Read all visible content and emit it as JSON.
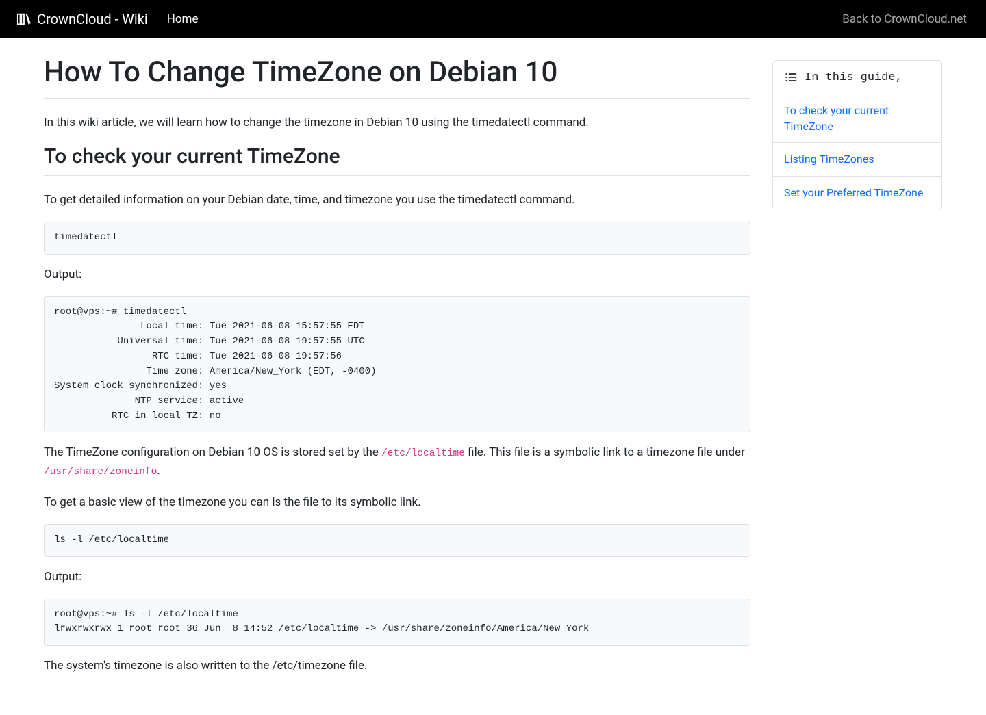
{
  "nav": {
    "brand": "CrownCloud - Wiki",
    "home": "Home",
    "back": "Back to CrownCloud.net"
  },
  "page": {
    "title": "How To Change TimeZone on Debian 10",
    "intro": "In this wiki article, we will learn how to change the timezone in Debian 10 using the timedatectl command.",
    "section1": {
      "heading": "To check your current TimeZone",
      "p1": "To get detailed information on your Debian date, time, and timezone you use the timedatectl command.",
      "code1": "timedatectl",
      "output_label_1": "Output:",
      "code2": "root@vps:~# timedatectl\n               Local time: Tue 2021-06-08 15:57:55 EDT\n           Universal time: Tue 2021-06-08 19:57:55 UTC\n                 RTC time: Tue 2021-06-08 19:57:56\n                Time zone: America/New_York (EDT, -0400)\nSystem clock synchronized: yes\n              NTP service: active\n          RTC in local TZ: no",
      "p2a": "The TimeZone configuration on Debian 10 OS is stored set by the ",
      "inline1": "/etc/localtime",
      "p2b": " file. This file is a symbolic link to a timezone file under ",
      "inline2": "/usr/share/zoneinfo",
      "p2c": ".",
      "p3": "To get a basic view of the timezone you can ls the file to its symbolic link.",
      "code3": "ls -l /etc/localtime",
      "output_label_2": "Output:",
      "code4": "root@vps:~# ls -l /etc/localtime\nlrwxrwxrwx 1 root root 36 Jun  8 14:52 /etc/localtime -> /usr/share/zoneinfo/America/New_York",
      "p4": "The system's timezone is also written to the /etc/timezone file."
    }
  },
  "toc": {
    "title": "In this guide,",
    "items": [
      "To check your current TimeZone",
      "Listing TimeZones",
      "Set your Preferred TimeZone"
    ]
  }
}
